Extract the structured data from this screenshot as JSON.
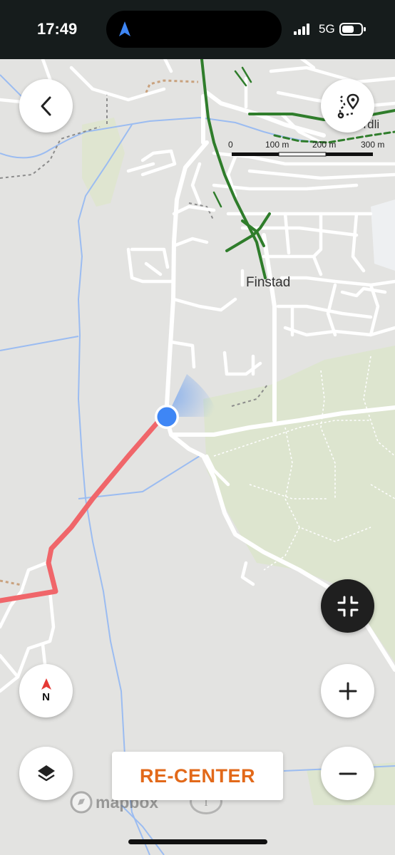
{
  "status_bar": {
    "time": "17:49",
    "network": "5G",
    "icons": [
      "navigation-arrow-icon",
      "signal-bars-icon",
      "battery-icon"
    ]
  },
  "map": {
    "place_labels": [
      "Finstad",
      "ordli"
    ],
    "scale_bar": {
      "labels": [
        "0",
        "100 m",
        "200 m",
        "300 m"
      ]
    },
    "route_color": "#f0666a",
    "user_location_color": "#3e86f5",
    "trail_color": "#2f7d2b",
    "water_color": "#9bbcf1",
    "forest_color": "#dde5cf"
  },
  "controls": {
    "back_icon": "chevron-left-icon",
    "route_poi_icon": "route-pin-icon",
    "collapse_icon": "collapse-arrows-icon",
    "compass_label": "N",
    "zoom_in_icon": "plus-icon",
    "zoom_out_icon": "minus-icon",
    "layers_icon": "layers-icon",
    "recenter_label": "RE-CENTER",
    "recenter_color": "#e2691a"
  },
  "attribution": {
    "logo_text": "mapbox",
    "info_label": "i"
  }
}
